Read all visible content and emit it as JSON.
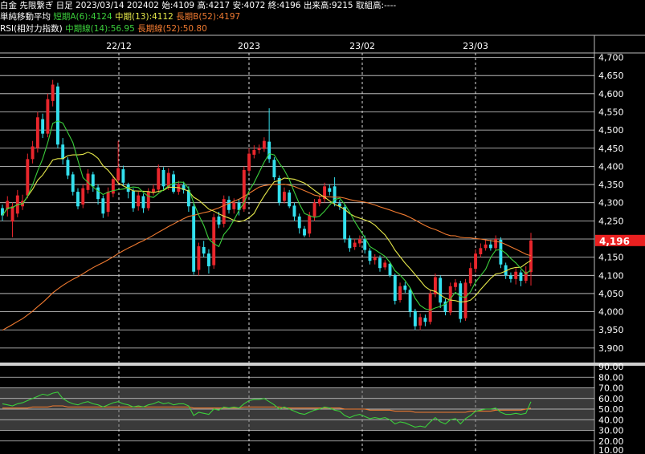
{
  "header": {
    "title": "白金 先限繋ぎ 日足",
    "date": "2023/03/14",
    "contract": "202402",
    "open_label": "始:",
    "open": "4109",
    "high_label": "高:",
    "high": "4217",
    "low_label": "安:",
    "low": "4072",
    "close_label": "終:",
    "close": "4196",
    "volume_label": "出来高:",
    "volume": "9215",
    "oi_label": "取組高:",
    "oi": "----",
    "ma_title": "単純移動平均",
    "ma_short_label": "短期A(6):",
    "ma_short_value": "4124",
    "ma_mid_label": "中期(13):",
    "ma_mid_value": "4112",
    "ma_long_label": "長期B(52):",
    "ma_long_value": "4197",
    "rsi_title": "RSI(相対力指数)",
    "rsi_mid_label": "中期線(14):",
    "rsi_mid_value": "56.95",
    "rsi_long_label": "長期線(52):",
    "rsi_long_value": "50.80"
  },
  "colors": {
    "background": "#000000",
    "up": "#e8262c",
    "down": "#33e0ee",
    "ma_short": "#3bcf3b",
    "ma_mid": "#e6e84a",
    "ma_long": "#f07a30",
    "rsi_mid": "#3bcf3b",
    "rsi_long": "#f07a30",
    "price_tag": "#ea2020"
  },
  "chart_data": [
    {
      "type": "candlestick",
      "x_labels": [
        "22/12",
        "2023",
        "23/02",
        "23/03"
      ],
      "ylim": [
        3860,
        4710
      ],
      "y_ticks": [
        "4,700",
        "4,650",
        "4,600",
        "4,550",
        "4,500",
        "4,450",
        "4,400",
        "4,350",
        "4,300",
        "4,250",
        "4,200",
        "4,150",
        "4,100",
        "4,050",
        "4,000",
        "3,950",
        "3,900"
      ],
      "last_price_label": "4,196",
      "last_price": 4196,
      "candles": [
        [
          4285,
          4265,
          4295,
          4250
        ],
        [
          4282,
          4305,
          4318,
          4262
        ],
        [
          4248,
          4290,
          4300,
          4205
        ],
        [
          4270,
          4320,
          4335,
          4260
        ],
        [
          4290,
          4305,
          4322,
          4280
        ],
        [
          4320,
          4420,
          4435,
          4312
        ],
        [
          4420,
          4455,
          4470,
          4408
        ],
        [
          4450,
          4535,
          4550,
          4438
        ],
        [
          4530,
          4490,
          4545,
          4478
        ],
        [
          4490,
          4585,
          4600,
          4480
        ],
        [
          4580,
          4625,
          4638,
          4565
        ],
        [
          4620,
          4460,
          4630,
          4450
        ],
        [
          4460,
          4420,
          4478,
          4405
        ],
        [
          4418,
          4375,
          4425,
          4365
        ],
        [
          4378,
          4330,
          4385,
          4320
        ],
        [
          4330,
          4290,
          4340,
          4282
        ],
        [
          4295,
          4340,
          4350,
          4285
        ],
        [
          4335,
          4380,
          4392,
          4325
        ],
        [
          4378,
          4345,
          4385,
          4330
        ],
        [
          4342,
          4310,
          4350,
          4295
        ],
        [
          4312,
          4270,
          4320,
          4258
        ],
        [
          4275,
          4330,
          4342,
          4262
        ],
        [
          4325,
          4365,
          4375,
          4315
        ],
        [
          4362,
          4395,
          4470,
          4350
        ],
        [
          4392,
          4355,
          4402,
          4345
        ],
        [
          4350,
          4330,
          4355,
          4312
        ],
        [
          4332,
          4285,
          4340,
          4275
        ],
        [
          4290,
          4320,
          4330,
          4278
        ],
        [
          4318,
          4285,
          4325,
          4272
        ],
        [
          4285,
          4330,
          4340,
          4278
        ],
        [
          4328,
          4338,
          4350,
          4320
        ],
        [
          4336,
          4395,
          4405,
          4328
        ],
        [
          4390,
          4345,
          4398,
          4336
        ],
        [
          4343,
          4382,
          4395,
          4335
        ],
        [
          4378,
          4330,
          4388,
          4325
        ],
        [
          4330,
          4350,
          4360,
          4322
        ],
        [
          4348,
          4335,
          4358,
          4325
        ],
        [
          4335,
          4290,
          4345,
          4275
        ],
        [
          4290,
          4110,
          4298,
          4102
        ],
        [
          4115,
          4180,
          4190,
          4100
        ],
        [
          4178,
          4160,
          4195,
          4150
        ],
        [
          4160,
          4125,
          4172,
          4105
        ],
        [
          4128,
          4260,
          4270,
          4118
        ],
        [
          4262,
          4240,
          4275,
          4230
        ],
        [
          4242,
          4310,
          4320,
          4232
        ],
        [
          4308,
          4280,
          4318,
          4270
        ],
        [
          4282,
          4300,
          4312,
          4270
        ],
        [
          4300,
          4280,
          4310,
          4265
        ],
        [
          4282,
          4390,
          4400,
          4275
        ],
        [
          4388,
          4435,
          4450,
          4380
        ],
        [
          4432,
          4445,
          4458,
          4422
        ],
        [
          4445,
          4450,
          4460,
          4435
        ],
        [
          4448,
          4470,
          4480,
          4440
        ],
        [
          4468,
          4420,
          4560,
          4410
        ],
        [
          4418,
          4370,
          4425,
          4362
        ],
        [
          4368,
          4300,
          4375,
          4292
        ],
        [
          4305,
          4330,
          4342,
          4298
        ],
        [
          4328,
          4290,
          4335,
          4285
        ],
        [
          4292,
          4262,
          4300,
          4250
        ],
        [
          4262,
          4230,
          4270,
          4215
        ],
        [
          4228,
          4210,
          4236,
          4205
        ],
        [
          4215,
          4265,
          4275,
          4205
        ],
        [
          4262,
          4300,
          4310,
          4250
        ],
        [
          4298,
          4310,
          4320,
          4290
        ],
        [
          4310,
          4345,
          4355,
          4300
        ],
        [
          4340,
          4330,
          4350,
          4320
        ],
        [
          4345,
          4300,
          4370,
          4290
        ],
        [
          4298,
          4290,
          4308,
          4280
        ],
        [
          4288,
          4200,
          4295,
          4190
        ],
        [
          4202,
          4175,
          4210,
          4165
        ],
        [
          4178,
          4190,
          4200,
          4170
        ],
        [
          4188,
          4200,
          4210,
          4178
        ],
        [
          4200,
          4170,
          4210,
          4160
        ],
        [
          4168,
          4140,
          4175,
          4130
        ],
        [
          4142,
          4150,
          4158,
          4130
        ],
        [
          4148,
          4120,
          4155,
          4110
        ],
        [
          4122,
          4135,
          4142,
          4115
        ],
        [
          4132,
          4100,
          4138,
          4095
        ],
        [
          4100,
          4030,
          4105,
          4020
        ],
        [
          4032,
          4070,
          4080,
          4025
        ],
        [
          4072,
          4060,
          4082,
          4052
        ],
        [
          4060,
          4000,
          4065,
          3985
        ],
        [
          4002,
          3960,
          4008,
          3950
        ],
        [
          3962,
          3985,
          3995,
          3950
        ],
        [
          3983,
          3972,
          3992,
          3960
        ],
        [
          3972,
          4050,
          4060,
          3965
        ],
        [
          4048,
          4095,
          4105,
          4040
        ],
        [
          4093,
          4025,
          4100,
          4010
        ],
        [
          4028,
          4000,
          4035,
          3990
        ],
        [
          3998,
          4070,
          4080,
          3990
        ],
        [
          4068,
          4080,
          4090,
          4058
        ],
        [
          4078,
          3980,
          4085,
          3970
        ],
        [
          3982,
          4080,
          4090,
          3975
        ],
        [
          4078,
          4120,
          4135,
          4070
        ],
        [
          4118,
          4160,
          4172,
          4108
        ],
        [
          4158,
          4175,
          4188,
          4150
        ],
        [
          4175,
          4185,
          4198,
          4168
        ],
        [
          4185,
          4175,
          4198,
          4168
        ],
        [
          4175,
          4200,
          4210,
          4168
        ],
        [
          4198,
          4130,
          4205,
          4120
        ],
        [
          4128,
          4100,
          4135,
          4090
        ],
        [
          4100,
          4090,
          4108,
          4080
        ],
        [
          4090,
          4110,
          4120,
          4075
        ],
        [
          4108,
          4085,
          4115,
          4070
        ],
        [
          4085,
          4110,
          4125,
          4078
        ],
        [
          4109,
          4196,
          4217,
          4072
        ]
      ]
    },
    {
      "type": "line",
      "title": "RSI",
      "ylim": [
        10,
        90
      ],
      "y_ticks": [
        "90.00",
        "80.00",
        "70.00",
        "60.00",
        "50.00",
        "40.00",
        "30.00",
        "20.00",
        "10.00"
      ],
      "band_70_30": true,
      "series_mid": [
        55,
        54,
        53,
        55,
        56,
        58,
        60,
        62,
        64,
        63,
        65,
        66,
        60,
        57,
        55,
        54,
        56,
        57,
        55,
        54,
        52,
        54,
        56,
        57,
        55,
        54,
        52,
        53,
        52,
        54,
        55,
        57,
        55,
        56,
        54,
        55,
        55,
        53,
        44,
        47,
        46,
        45,
        50,
        49,
        52,
        51,
        52,
        51,
        55,
        58,
        59,
        59,
        60,
        57,
        54,
        50,
        52,
        50,
        48,
        46,
        45,
        47,
        49,
        50,
        52,
        51,
        49,
        48,
        44,
        42,
        44,
        45,
        43,
        41,
        42,
        41,
        42,
        40,
        36,
        38,
        37,
        35,
        33,
        34,
        33,
        38,
        42,
        38,
        36,
        40,
        41,
        36,
        41,
        44,
        48,
        49,
        50,
        50,
        51,
        47,
        45,
        45,
        46,
        45,
        46,
        56.95
      ],
      "series_long": [
        51,
        51,
        51,
        51,
        51,
        51,
        52,
        52,
        52,
        52,
        53,
        53,
        53,
        52,
        52,
        52,
        52,
        52,
        52,
        52,
        52,
        52,
        52,
        52,
        52,
        52,
        52,
        52,
        52,
        52,
        52,
        52,
        52,
        52,
        52,
        52,
        52,
        52,
        51,
        51,
        51,
        51,
        51,
        51,
        51,
        51,
        51,
        51,
        52,
        52,
        52,
        52,
        52,
        52,
        52,
        52,
        51,
        51,
        51,
        51,
        51,
        51,
        51,
        51,
        51,
        51,
        51,
        51,
        50,
        50,
        50,
        50,
        50,
        49,
        49,
        49,
        49,
        49,
        48,
        48,
        48,
        48,
        47,
        47,
        47,
        47,
        47,
        47,
        47,
        47,
        47,
        47,
        47,
        48,
        48,
        48,
        48,
        48,
        49,
        49,
        49,
        49,
        49,
        49,
        50,
        50.8
      ]
    }
  ]
}
